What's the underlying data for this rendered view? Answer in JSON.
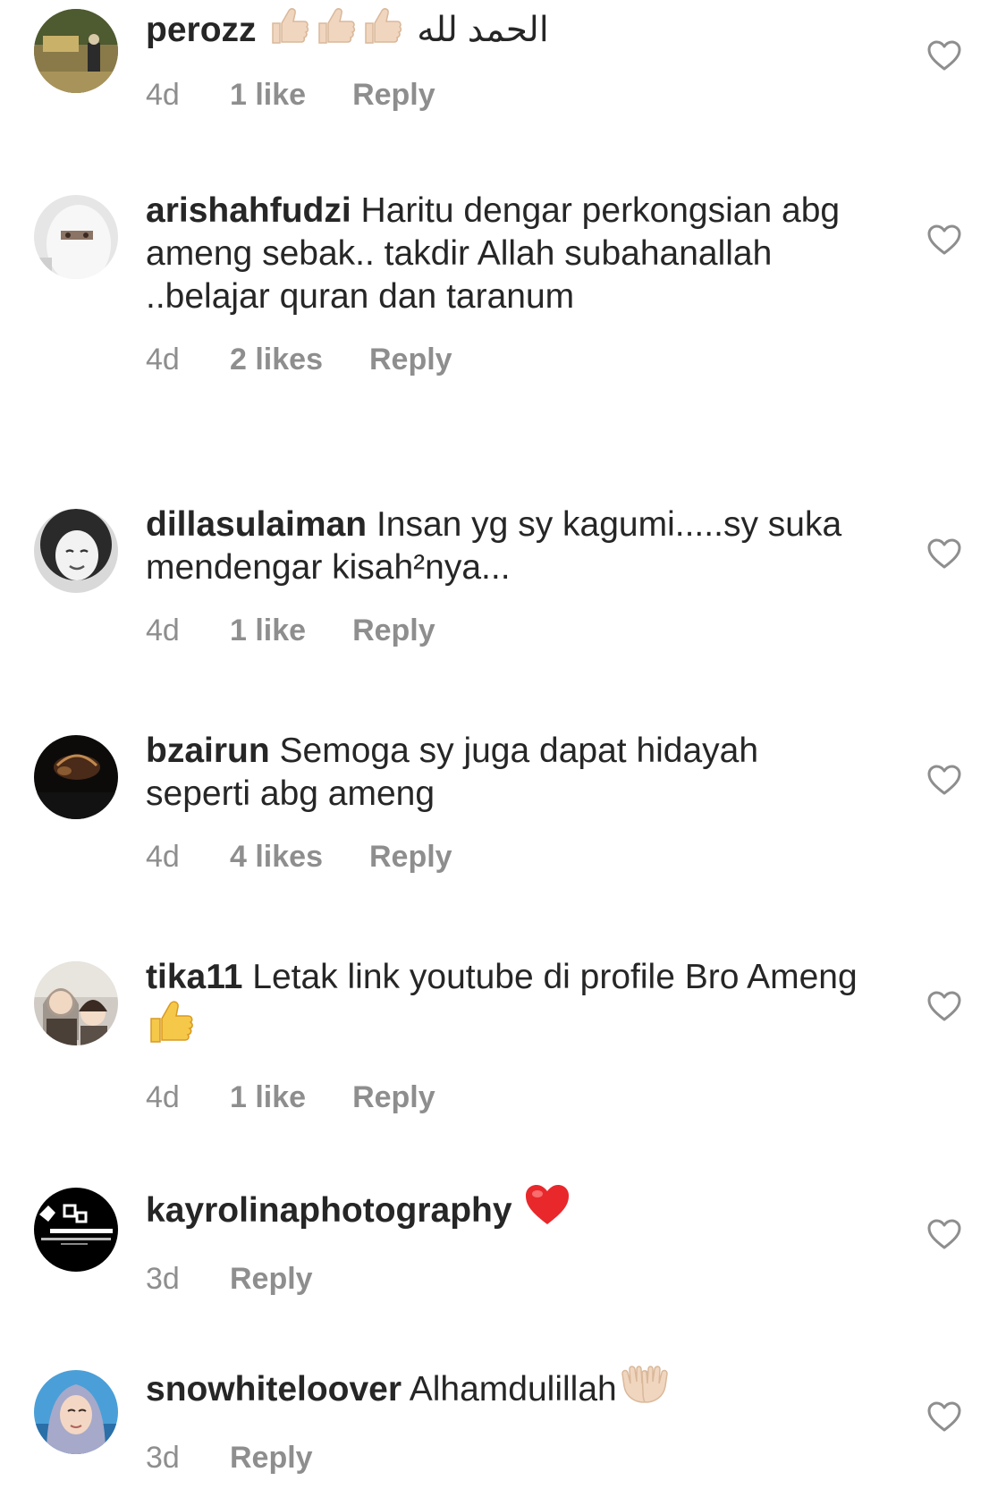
{
  "comments": [
    {
      "username": "perozz",
      "text": "",
      "emoji_after": "👍🏻👍🏻👍🏻",
      "text_after": " الحمد لله",
      "time": "4d",
      "likes": "1 like",
      "reply_label": "Reply",
      "avatar_icon": "avatar-photo-outdoor"
    },
    {
      "username": "arishahfudzi",
      "text": "Haritu dengar perkongsian abg ameng sebak.. takdir Allah subahanallah ..belajar quran dan taranum",
      "time": "4d",
      "likes": "2 likes",
      "reply_label": "Reply",
      "avatar_icon": "avatar-photo-veiled"
    },
    {
      "username": "dillasulaiman",
      "text": "Insan yg sy kagumi.....sy suka mendengar kisah²nya...",
      "time": "4d",
      "likes": "1 like",
      "reply_label": "Reply",
      "avatar_icon": "avatar-photo-portrait"
    },
    {
      "username": "bzairun",
      "text": "Semoga sy juga dapat hidayah seperti abg ameng",
      "time": "4d",
      "likes": "4 likes",
      "reply_label": "Reply",
      "avatar_icon": "avatar-photo-dark"
    },
    {
      "username": "tika11",
      "text": "Letak link youtube di profile Bro Ameng",
      "emoji_after": "👍",
      "time": "4d",
      "likes": "1 like",
      "reply_label": "Reply",
      "avatar_icon": "avatar-photo-group"
    },
    {
      "username": "kayrolinaphotography",
      "text": "",
      "emoji_after": "❤️",
      "time": "3d",
      "likes": "",
      "reply_label": "Reply",
      "avatar_icon": "avatar-logo-photography"
    },
    {
      "username": "snowhiteloover",
      "text": "Alhamdulillah",
      "emoji_after": "🤲🏻",
      "time": "3d",
      "likes": "",
      "reply_label": "Reply",
      "avatar_icon": "avatar-photo-hijab"
    }
  ],
  "colors": {
    "text": "#262626",
    "secondary": "#8e8e8e",
    "heart_outline": "#8e8e8e",
    "emoji_red_heart": "#e8282b",
    "emoji_thumb": "#f5c84a",
    "emoji_thumb_light": "#f1d6bf"
  },
  "icons": {
    "like": "heart-outline-icon"
  }
}
